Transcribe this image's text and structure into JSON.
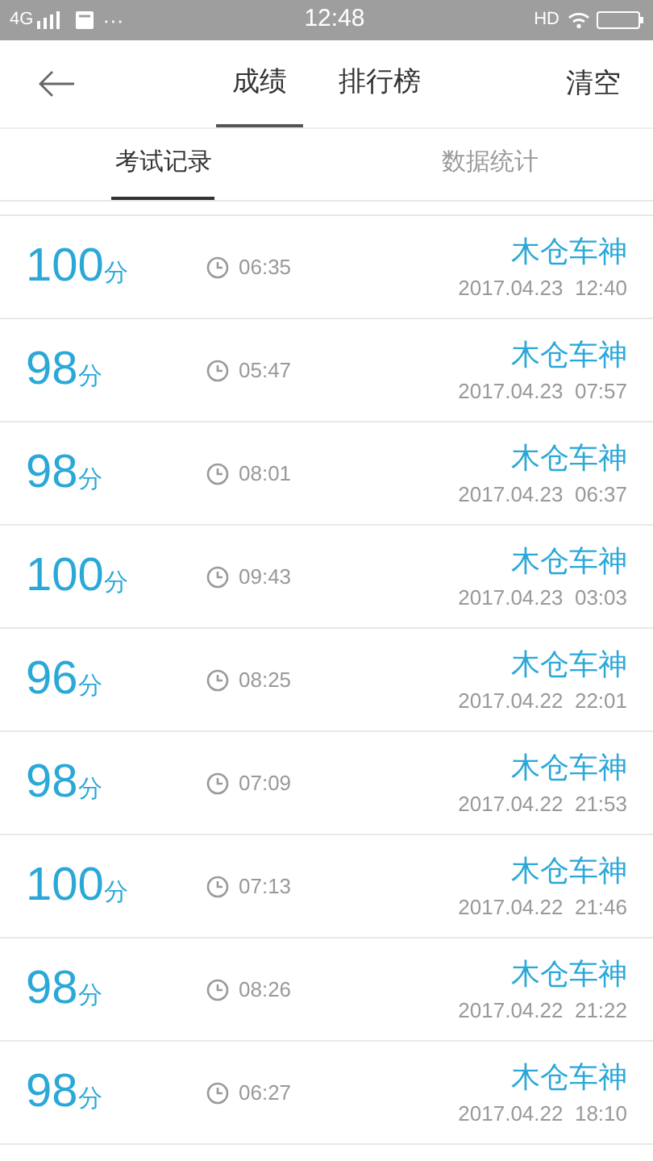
{
  "status_bar": {
    "network": "4G",
    "dots": "···",
    "time": "12:48",
    "hd": "HD"
  },
  "header": {
    "tabs": [
      {
        "label": "成绩",
        "selected": true
      },
      {
        "label": "排行榜",
        "selected": false
      }
    ],
    "action": "清空"
  },
  "subtabs": [
    {
      "label": "考试记录",
      "selected": true
    },
    {
      "label": "数据统计",
      "selected": false
    }
  ],
  "records": [
    {
      "score": "100",
      "unit": "分",
      "duration": "06:35",
      "name": "木仓车神",
      "date": "2017.04.23  12:40"
    },
    {
      "score": "98",
      "unit": "分",
      "duration": "05:47",
      "name": "木仓车神",
      "date": "2017.04.23  07:57"
    },
    {
      "score": "98",
      "unit": "分",
      "duration": "08:01",
      "name": "木仓车神",
      "date": "2017.04.23  06:37"
    },
    {
      "score": "100",
      "unit": "分",
      "duration": "09:43",
      "name": "木仓车神",
      "date": "2017.04.23  03:03"
    },
    {
      "score": "96",
      "unit": "分",
      "duration": "08:25",
      "name": "木仓车神",
      "date": "2017.04.22  22:01"
    },
    {
      "score": "98",
      "unit": "分",
      "duration": "07:09",
      "name": "木仓车神",
      "date": "2017.04.22  21:53"
    },
    {
      "score": "100",
      "unit": "分",
      "duration": "07:13",
      "name": "木仓车神",
      "date": "2017.04.22  21:46"
    },
    {
      "score": "98",
      "unit": "分",
      "duration": "08:26",
      "name": "木仓车神",
      "date": "2017.04.22  21:22"
    },
    {
      "score": "98",
      "unit": "分",
      "duration": "06:27",
      "name": "木仓车神",
      "date": "2017.04.22  18:10"
    }
  ]
}
